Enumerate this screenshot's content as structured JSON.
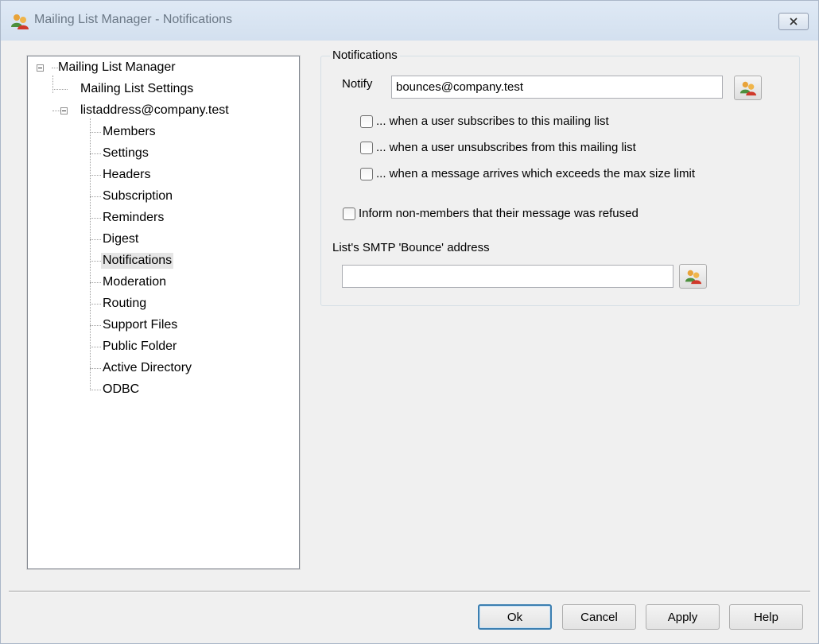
{
  "window": {
    "title": "Mailing List Manager - Notifications",
    "icon": "users-group-icon",
    "close_icon": "close-icon"
  },
  "tree": {
    "root": "Mailing List Manager",
    "mailing_list_settings": "Mailing List Settings",
    "list": "listaddress@company.test",
    "children": [
      "Members",
      "Settings",
      "Headers",
      "Subscription",
      "Reminders",
      "Digest",
      "Notifications",
      "Moderation",
      "Routing",
      "Support Files",
      "Public Folder",
      "Active Directory",
      "ODBC"
    ],
    "selected": "Notifications"
  },
  "notifications": {
    "group_title": "Notifications",
    "notify_label": "Notify",
    "notify_value": "bounces@company.test",
    "options": [
      {
        "label": "... when a user subscribes to this mailing list",
        "checked": false
      },
      {
        "label": "... when a user unsubscribes from this mailing list",
        "checked": false
      },
      {
        "label": "... when a message arrives which exceeds the max size limit",
        "checked": false
      }
    ],
    "inform_label": "Inform non-members that their message was refused",
    "inform_checked": false,
    "bounce_label": "List's SMTP 'Bounce' address",
    "bounce_value": ""
  },
  "buttons": {
    "ok": "Ok",
    "cancel": "Cancel",
    "apply": "Apply",
    "help": "Help"
  },
  "colors": {
    "accent": "#3c7fb1",
    "window_bg": "#f0f0f0",
    "tree_selection": "#e5e5e5"
  }
}
